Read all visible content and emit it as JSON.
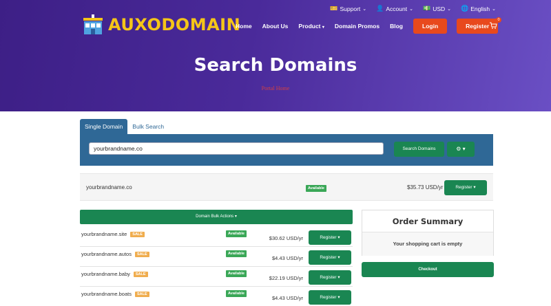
{
  "topbar": {
    "support": "Support",
    "account": "Account",
    "currency": "USD",
    "language": "English"
  },
  "logo": {
    "text": "AUXODOMAIN"
  },
  "nav": {
    "home": "Home",
    "about": "About Us",
    "product": "Product",
    "promos": "Domain Promos",
    "blog": "Blog",
    "login": "Login",
    "register": "Register",
    "cart_count": "0"
  },
  "hero": {
    "title": "Search Domains",
    "subtitle": "Portal Home"
  },
  "tabs": [
    {
      "label": "Single Domain"
    },
    {
      "label": "Bulk Search"
    }
  ],
  "search": {
    "value": "yourbrandname.co",
    "button": "Search Domains",
    "gear": "⚙ ▾"
  },
  "result": {
    "domain": "yourbrandname.co",
    "status": "Available",
    "price": "$35.73 USD/yr",
    "register": "Register ▾"
  },
  "bulk": {
    "actions_label": "Domain Bulk Actions ▾",
    "rows": [
      {
        "domain": "yourbrandname.site",
        "tag": "SALE",
        "status": "Available",
        "price": "$30.62 USD/yr",
        "register": "Register ▾"
      },
      {
        "domain": "yourbrandname.autos",
        "tag": "SALE",
        "status": "Available",
        "price": "$4.43 USD/yr",
        "register": "Register ▾"
      },
      {
        "domain": "yourbrandname.baby",
        "tag": "SALE",
        "status": "Available",
        "price": "$22.19 USD/yr",
        "register": "Register ▾"
      },
      {
        "domain": "yourbrandname.boats",
        "tag": "SALE",
        "status": "Available",
        "price": "$4.43 USD/yr",
        "register": "Register ▾"
      }
    ]
  },
  "summary": {
    "title": "Order Summary",
    "empty": "Your shopping cart is empty",
    "checkout": "Checkout"
  },
  "colors": {
    "hero_start": "#3d1f86",
    "hero_end": "#6a4fc4",
    "accent_red": "#e8491d",
    "panel_blue": "#2f6896",
    "green": "#1a8652",
    "logo_yellow": "#f5c518"
  }
}
